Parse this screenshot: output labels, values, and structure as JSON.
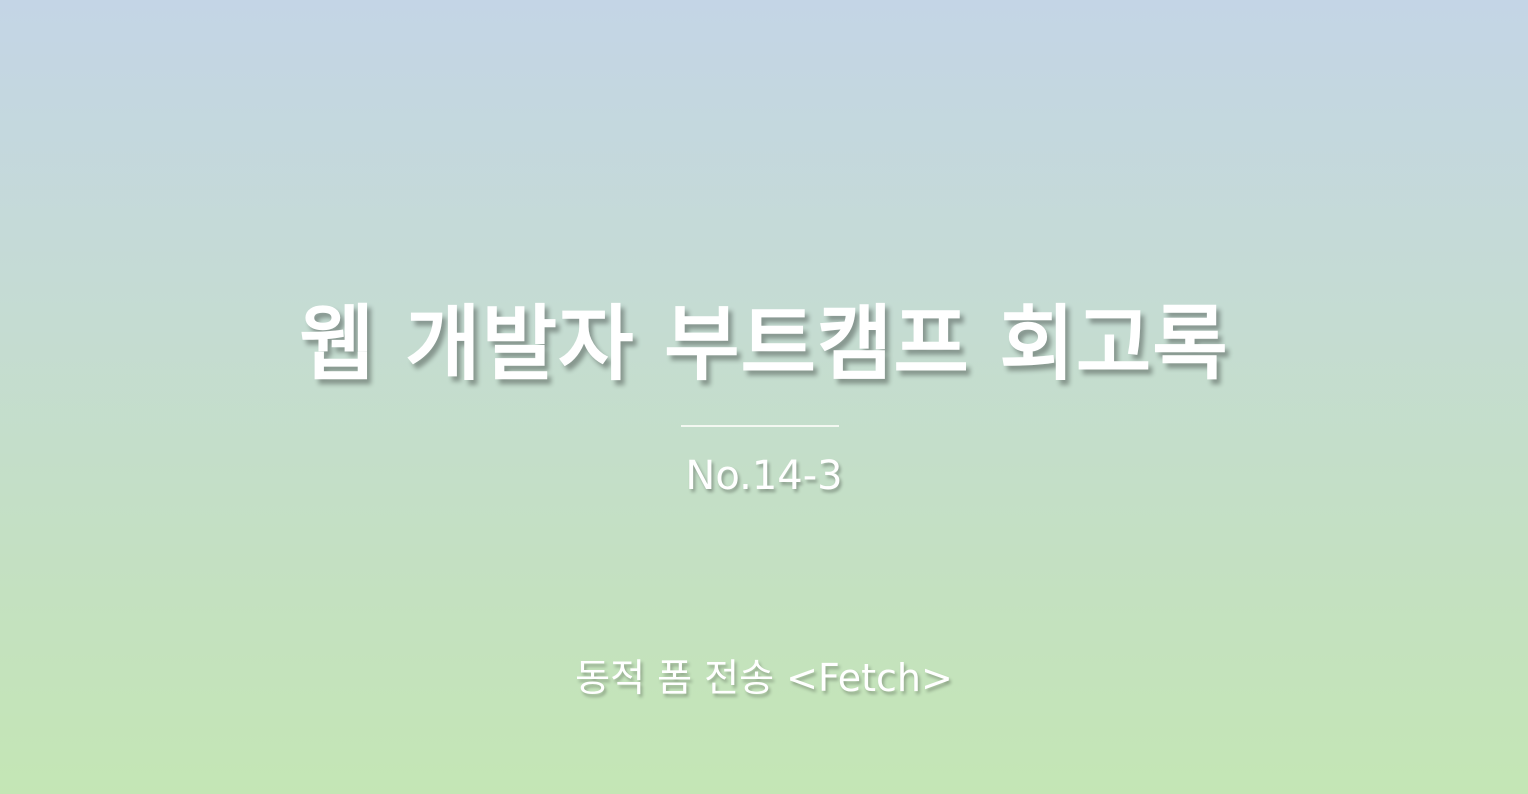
{
  "cover": {
    "title": "웹 개발자 부트캠프 회고록",
    "number": "No.14-3",
    "subtitle": "동적 폼 전송 <Fetch>"
  },
  "colors": {
    "gradient_top": "#c4d5e6",
    "gradient_bottom": "#c4e6b5",
    "text": "#ffffff"
  }
}
